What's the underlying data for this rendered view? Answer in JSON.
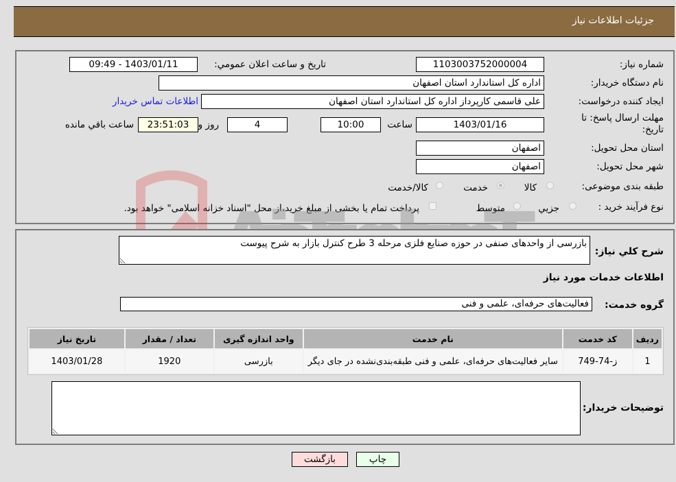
{
  "header": {
    "title": "جزئیات اطلاعات نیاز"
  },
  "colors": {
    "header_bg": "#8b6b42",
    "page_bg": "#e0e0e0",
    "link": "#1a1ae6",
    "back_button_bg": "#ffdcdc",
    "print_button_bg": "#e8ffe8",
    "remaining_time_bg": "#ffffe6"
  },
  "form": {
    "need_number": {
      "label": "شماره نیاز:",
      "value": "1103003752000004"
    },
    "announce_datetime": {
      "label": "تاریخ و ساعت اعلان عمومي:",
      "value": "1403/01/11 - 09:49"
    },
    "buyer_org": {
      "label": "نام دستگاه خريدار:",
      "value": "اداره کل استاندارد استان اصفهان"
    },
    "requester": {
      "label": "ایجاد کننده درخواست:",
      "value": "علی قاسمی کارپرداز اداره کل استاندارد استان اصفهان"
    },
    "buyer_contact_link": "اطلاعات تماس خریدار",
    "deadline": {
      "label": "مهلت ارسال پاسخ: تا تاریخ:",
      "date": "1403/01/16",
      "time_label": "ساعت",
      "time": "10:00",
      "days": "4",
      "days_label": "روز و",
      "remaining": "23:51:03",
      "remaining_label": "ساعت باقي مانده"
    },
    "delivery_province": {
      "label": "استان محل تحویل:",
      "value": "اصفهان"
    },
    "delivery_city": {
      "label": "شهر محل تحویل:",
      "value": "اصفهان"
    },
    "category": {
      "label": "طبقه بندی موضوعی:",
      "options": [
        "کالا",
        "خدمت",
        "کالا/خدمت"
      ],
      "selected": "خدمت"
    },
    "purchase_process": {
      "label": "نوع فرآیند خرید :",
      "options": [
        "جزيي",
        "متوسط"
      ],
      "treasury_note": "پرداخت تمام یا بخشی از مبلغ خرید،از محل \"اسناد خزانه اسلامی\" خواهد بود."
    }
  },
  "details": {
    "description_label": "شرح کلي نياز:",
    "description": "بازرسی از واحدهای صنفی در حوزه صنایع فلزی مرحله 3 طرح کنترل بازار به شرح پیوست",
    "services_heading": "اطلاعات خدمات مورد نیاز",
    "service_group_label": "گروه خدمت:",
    "service_group": "فعالیت‌های حرفه‌ای، علمی و فنی",
    "table": {
      "headers": [
        "ردیف",
        "کد خدمت",
        "نام خدمت",
        "واحد اندازه گیری",
        "تعداد / مقدار",
        "تاریخ نیاز"
      ],
      "rows": [
        [
          "1",
          "ز-74-749",
          "سایر فعالیت‌های حرفه‌ای، علمی و فنی طبقه‌بندی‌نشده در جای دیگر",
          "بازرسی",
          "1920",
          "1403/01/28"
        ]
      ]
    },
    "buyer_notes_label": "توضیحات خریدار:",
    "buyer_notes": ""
  },
  "buttons": {
    "print": "چاپ",
    "back": "بازگشت"
  },
  "watermark": {
    "text": "AriaTender.neT"
  }
}
